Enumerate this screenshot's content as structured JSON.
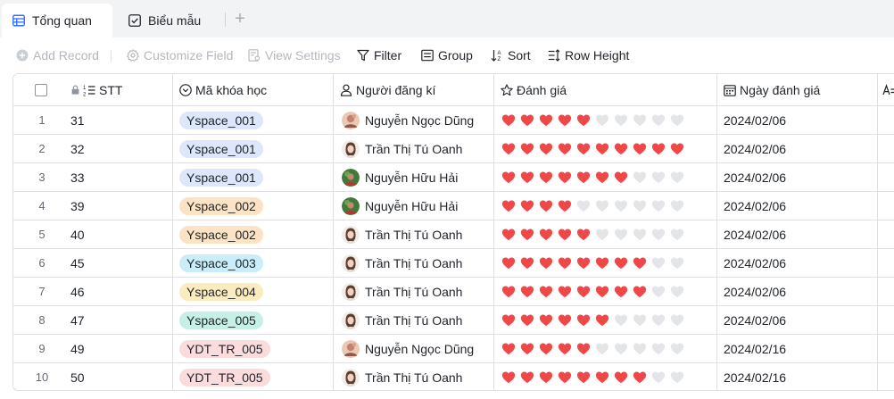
{
  "tabs": [
    {
      "label": "Tổng quan",
      "icon": "table-icon",
      "active": true
    },
    {
      "label": "Biểu mẫu",
      "icon": "form-icon",
      "active": false
    }
  ],
  "tab_add_label": "+",
  "toolbar": {
    "add_record": "Add Record",
    "customize_field": "Customize Field",
    "view_settings": "View Settings",
    "filter": "Filter",
    "group": "Group",
    "sort": "Sort",
    "row_height": "Row Height"
  },
  "columns": {
    "stt": "STT",
    "course_code": "Mã khóa học",
    "registrant": "Người đăng kí",
    "rating": "Đánh giá",
    "review_date": "Ngày đánh giá"
  },
  "rating_max": 10,
  "colors": {
    "heart_on": "#f04848",
    "heart_off": "#e3e5e8",
    "tag_blue": "#dce7fc",
    "tag_orange": "#fde3c6",
    "tag_cyan": "#c9eef9",
    "tag_yellow": "#fbecc0",
    "tag_teal": "#c6f0e6",
    "tag_pink": "#fbdcdc"
  },
  "rows": [
    {
      "num": "1",
      "stt": "31",
      "course": "Yspace_001",
      "tag_color": "blue",
      "person": "Nguyễn Ngọc Dũng",
      "avatar": "avatar-dung",
      "rating": 5,
      "date": "2024/02/06"
    },
    {
      "num": "2",
      "stt": "32",
      "course": "Yspace_001",
      "tag_color": "blue",
      "person": "Trần Thị Tú Oanh",
      "avatar": "avatar-oanh",
      "rating": 10,
      "date": "2024/02/06"
    },
    {
      "num": "3",
      "stt": "33",
      "course": "Yspace_001",
      "tag_color": "blue",
      "person": "Nguyễn Hữu Hải",
      "avatar": "avatar-hai",
      "rating": 7,
      "date": "2024/02/06"
    },
    {
      "num": "4",
      "stt": "39",
      "course": "Yspace_002",
      "tag_color": "orange",
      "person": "Nguyễn Hữu Hải",
      "avatar": "avatar-hai",
      "rating": 4,
      "date": "2024/02/06"
    },
    {
      "num": "5",
      "stt": "40",
      "course": "Yspace_002",
      "tag_color": "orange",
      "person": "Trần Thị Tú Oanh",
      "avatar": "avatar-oanh",
      "rating": 5,
      "date": "2024/02/06"
    },
    {
      "num": "6",
      "stt": "45",
      "course": "Yspace_003",
      "tag_color": "cyan",
      "person": "Trần Thị Tú Oanh",
      "avatar": "avatar-oanh",
      "rating": 8,
      "date": "2024/02/06"
    },
    {
      "num": "7",
      "stt": "46",
      "course": "Yspace_004",
      "tag_color": "yellow",
      "person": "Trần Thị Tú Oanh",
      "avatar": "avatar-oanh",
      "rating": 8,
      "date": "2024/02/06"
    },
    {
      "num": "8",
      "stt": "47",
      "course": "Yspace_005",
      "tag_color": "teal",
      "person": "Trần Thị Tú Oanh",
      "avatar": "avatar-oanh",
      "rating": 6,
      "date": "2024/02/06"
    },
    {
      "num": "9",
      "stt": "49",
      "course": "YDT_TR_005",
      "tag_color": "pink",
      "person": "Nguyễn Ngọc Dũng",
      "avatar": "avatar-dung",
      "rating": 5,
      "date": "2024/02/16"
    },
    {
      "num": "10",
      "stt": "50",
      "course": "YDT_TR_005",
      "tag_color": "pink",
      "person": "Trần Thị Tú Oanh",
      "avatar": "avatar-oanh",
      "rating": 8,
      "date": "2024/02/16"
    }
  ]
}
